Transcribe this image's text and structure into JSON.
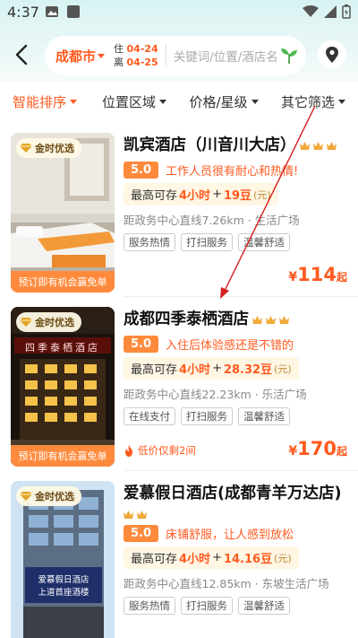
{
  "status": {
    "time": "4:37"
  },
  "header": {
    "city": "成都市",
    "checkin_label": "住",
    "checkin_date": "04-24",
    "checkout_label": "离",
    "checkout_date": "04-25",
    "search_placeholder": "关键词/位置/酒店名"
  },
  "filters": [
    {
      "label": "智能排序",
      "active": true
    },
    {
      "label": "位置区域",
      "active": false
    },
    {
      "label": "价格/星级",
      "active": false
    },
    {
      "label": "其它筛选",
      "active": false
    }
  ],
  "hotels": [
    {
      "badge": "金时优选",
      "promo": "预订即有机会赢免单",
      "name": "凯宾酒店（川音川大店）",
      "score": "5.0",
      "review": "工作人员很有耐心和热情!",
      "stay_prefix": "最高可存",
      "stay_hours": "4小时",
      "stay_plus": "+",
      "stay_beans": "19豆",
      "stay_unit": "(元)",
      "distance": "距政务中心直线7.26km · 生活广场",
      "tags": [
        "服务热情",
        "打扫服务",
        "温馨舒适"
      ],
      "price_currency": "¥",
      "price": "114",
      "price_suffix": "起"
    },
    {
      "badge": "金时优选",
      "promo": "预订即有机会赢免单",
      "name": "成都四季泰栖酒店",
      "score": "5.0",
      "review": "入住后体验感还是不错的",
      "stay_prefix": "最高可存",
      "stay_hours": "4小时",
      "stay_plus": "+",
      "stay_beans": "28.32豆",
      "stay_unit": "(元)",
      "distance": "距政务中心直线22.23km · 乐活广场",
      "tags": [
        "在线支付",
        "打扫服务",
        "温馨舒适"
      ],
      "low_price_note": "低价仅剩2间",
      "price_currency": "¥",
      "price": "170",
      "price_suffix": "起",
      "sign_text": "四季泰栖酒店"
    },
    {
      "badge": "金时优选",
      "name": "爱慕假日酒店(成都青羊万达店)",
      "score": "5.0",
      "review": "床铺舒服，让人感到放松",
      "stay_prefix": "最高可存",
      "stay_hours": "4小时",
      "stay_plus": "+",
      "stay_beans": "14.16豆",
      "stay_unit": "(元)",
      "distance": "距政务中心直线12.85km · 东坡生活广场",
      "tags": [
        "服务热情",
        "打扫服务",
        "温馨舒适"
      ],
      "sign_text_1": "爱慕假日酒店",
      "sign_text_2": "上道首座酒楼"
    }
  ],
  "colors": {
    "accent": "#ff5a1f",
    "score_bg": "#ff8a3c"
  }
}
